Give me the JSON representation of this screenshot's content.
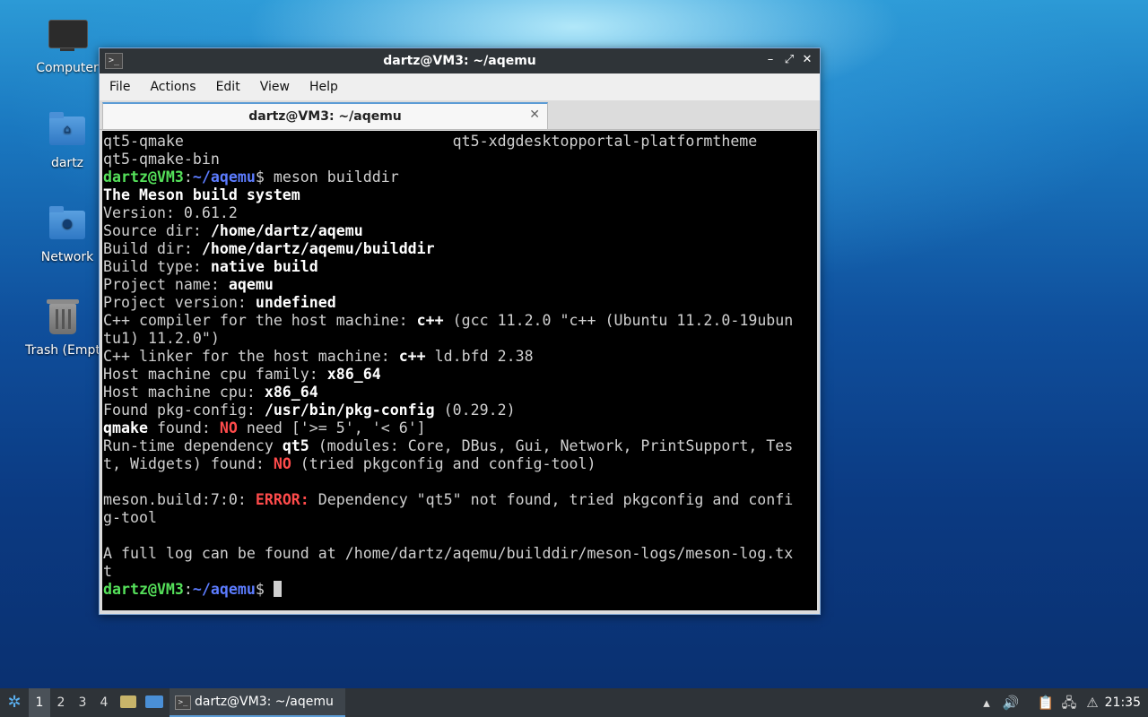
{
  "desktop": {
    "icons": [
      {
        "label": "Computer",
        "icon": "computer-icon"
      },
      {
        "label": "dartz",
        "icon": "home-folder-icon"
      },
      {
        "label": "Network",
        "icon": "network-folder-icon"
      },
      {
        "label": "Trash (Empt",
        "icon": "trash-icon"
      }
    ]
  },
  "window": {
    "title": "dartz@VM3: ~/aqemu",
    "minimize": "–",
    "maximize": "⤢",
    "close": "✕",
    "menu": [
      "File",
      "Actions",
      "Edit",
      "View",
      "Help"
    ],
    "tab": {
      "label": "dartz@VM3: ~/aqemu",
      "close": "✕"
    }
  },
  "terminal": {
    "prompt_user": "dartz@VM3",
    "prompt_path": "~/aqemu",
    "prompt_sep": ":",
    "prompt_end": "$",
    "lines": [
      "qt5-qmake                              qt5-xdgdesktopportal-platformtheme",
      "qt5-qmake-bin",
      "meson builddir",
      "The Meson build system",
      "Version: 0.61.2",
      "Source dir: /home/dartz/aqemu",
      "Build dir: /home/dartz/aqemu/builddir",
      "Build type: native build",
      "Project name: aqemu",
      "Project version: undefined",
      "C++ compiler for the host machine: c++ (gcc 11.2.0 \"c++ (Ubuntu 11.2.0-19ubuntu1) 11.2.0\")",
      "C++ linker for the host machine: c++ ld.bfd 2.38",
      "Host machine cpu family: x86_64",
      "Host machine cpu: x86_64",
      "Found pkg-config: /usr/bin/pkg-config (0.29.2)",
      "qmake found: NO need ['>= 5', '< 6']",
      "Run-time dependency qt5 (modules: Core, DBus, Gui, Network, PrintSupport, Test, Widgets) found: NO (tried pkgconfig and config-tool)",
      "meson.build:7:0: ERROR: Dependency \"qt5\" not found, tried pkgconfig and config-tool",
      "A full log can be found at /home/dartz/aqemu/builddir/meson-logs/meson-log.txt"
    ]
  },
  "taskbar": {
    "workspaces": [
      "1",
      "2",
      "3",
      "4"
    ],
    "active_workspace": "1",
    "task_label": "dartz@VM3: ~/aqemu",
    "clock": "21:35"
  }
}
